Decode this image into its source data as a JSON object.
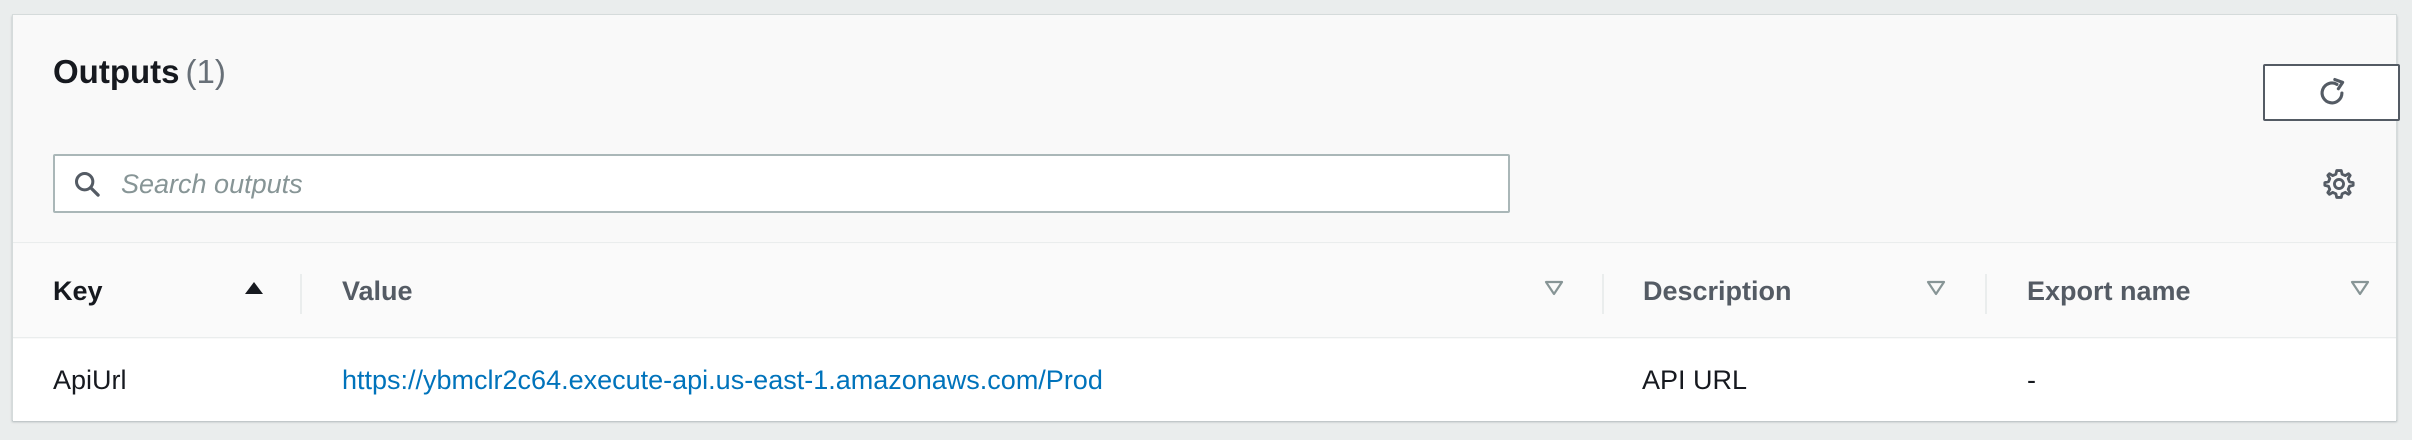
{
  "outputs": {
    "title": "Outputs",
    "count": "(1)",
    "search": {
      "placeholder": "Search outputs",
      "value": ""
    },
    "columns": {
      "key": "Key",
      "value": "Value",
      "description": "Description",
      "export_name": "Export name"
    },
    "sort": {
      "column": "key",
      "direction": "ascending"
    },
    "rows": [
      {
        "key": "ApiUrl",
        "value": "https://ybmclr2c64.execute-api.us-east-1.amazonaws.com/Prod",
        "description": "API URL",
        "export_name": "-"
      }
    ]
  },
  "icons": {
    "refresh": "refresh-icon",
    "search": "search-icon",
    "settings": "gear-icon",
    "sort_asc": "caret-up-icon",
    "sort_none": "caret-down-outline-icon"
  },
  "colors": {
    "link": "#0073bb",
    "heading": "#16191f",
    "muted": "#687078",
    "border": "#aab7b8"
  }
}
